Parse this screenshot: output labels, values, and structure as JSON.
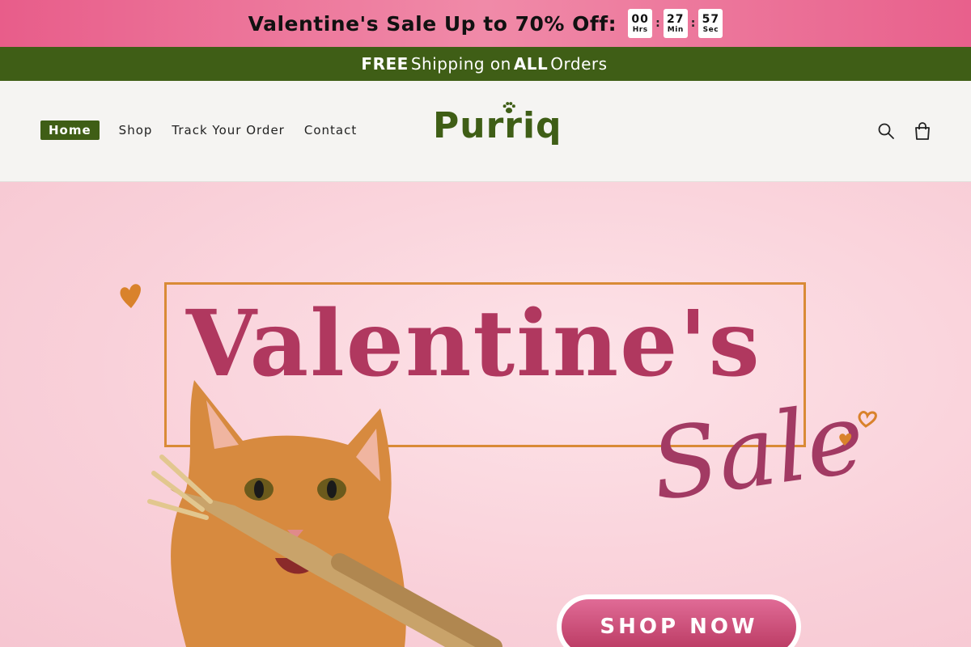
{
  "promo": {
    "text": "Valentine's Sale Up to 70% Off:",
    "timer": [
      {
        "value": "00",
        "label": "Hrs"
      },
      {
        "value": "27",
        "label": "Min"
      },
      {
        "value": "57",
        "label": "Sec"
      }
    ]
  },
  "shipping": {
    "free": "FREE",
    "middle": "Shipping on",
    "all": "ALL",
    "end": "Orders"
  },
  "nav": {
    "items": [
      "Home",
      "Shop",
      "Track Your Order",
      "Contact"
    ]
  },
  "brand": {
    "name": "Purriq"
  },
  "header_icons": [
    "search-icon",
    "cart-icon"
  ],
  "hero": {
    "title": "Valentine's",
    "script": "Sale",
    "cta": "SHOP NOW"
  },
  "colors": {
    "brand_green": "#3f5e16",
    "promo_pink": "#ee7a9c",
    "hero_pink": "#b0385f"
  }
}
